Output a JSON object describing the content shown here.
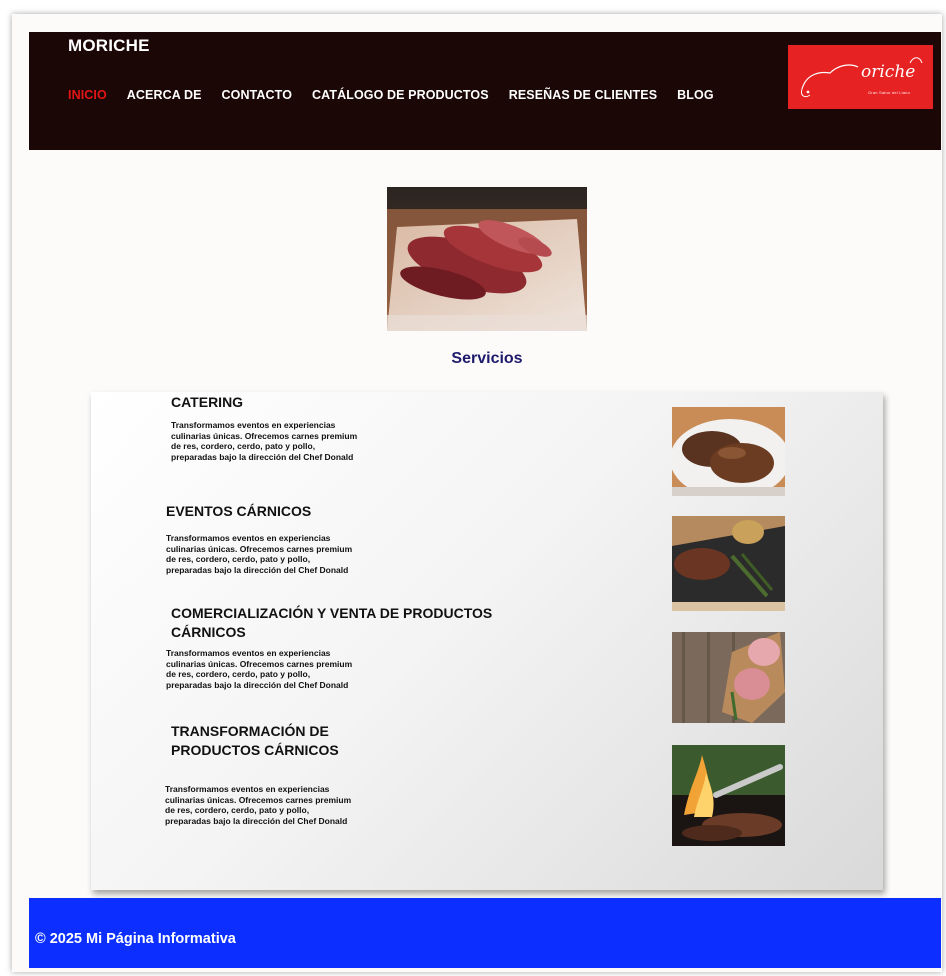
{
  "header": {
    "brand": "MORICHE",
    "nav": [
      {
        "label": "INICIO",
        "active": true
      },
      {
        "label": "ACERCA DE"
      },
      {
        "label": "CONTACTO"
      },
      {
        "label": "CATÁLOGO DE PRODUCTOS"
      },
      {
        "label": "RESEÑAS DE CLIENTES"
      },
      {
        "label": "BLOG"
      }
    ],
    "logo": {
      "word": "oriche",
      "tagline": "Gran Sabor del Llano"
    }
  },
  "main": {
    "services_title": "Servicios",
    "services": [
      {
        "title": "CATERING",
        "description": "Transformamos eventos en experiencias\nculinarias únicas. Ofrecemos carnes premium\n de res, cordero, cerdo, pato y pollo,\npreparadas bajo la dirección del Chef Donald",
        "image_icon": "grilled-steak-plate-image"
      },
      {
        "title": "EVENTOS CÁRNICOS",
        "description": "Transformamos eventos en experiencias\nculinarias únicas. Ofrecemos carnes premium\n de res, cordero, cerdo, pato y pollo,\npreparadas bajo la dirección del Chef Donald",
        "image_icon": "steak-board-image"
      },
      {
        "title": "COMERCIALIZACIÓN Y VENTA DE PRODUCTOS\nCÁRNICOS",
        "description": "Transformamos eventos en experiencias\nculinarias únicas. Ofrecemos carnes premium\n de res, cordero, cerdo, pato y pollo,\npreparadas bajo la dirección del Chef Donald",
        "image_icon": "raw-meat-board-image"
      },
      {
        "title": "TRANSFORMACIÓN DE\nPRODUCTOS CÁRNICOS",
        "description": "Transformamos eventos en experiencias\nculinarias únicas. Ofrecemos carnes premium\n de res, cordero, cerdo, pato y pollo,\npreparadas bajo la dirección del Chef Donald",
        "image_icon": "grill-flames-image"
      }
    ]
  },
  "footer": {
    "text": "© 2025 Mi Página Informativa"
  },
  "colors": {
    "header_bg": "#1a0706",
    "nav_active": "#e31414",
    "logo_bg": "#e62222",
    "services_title": "#1d1a6b",
    "footer_bg": "#0c2fff"
  }
}
